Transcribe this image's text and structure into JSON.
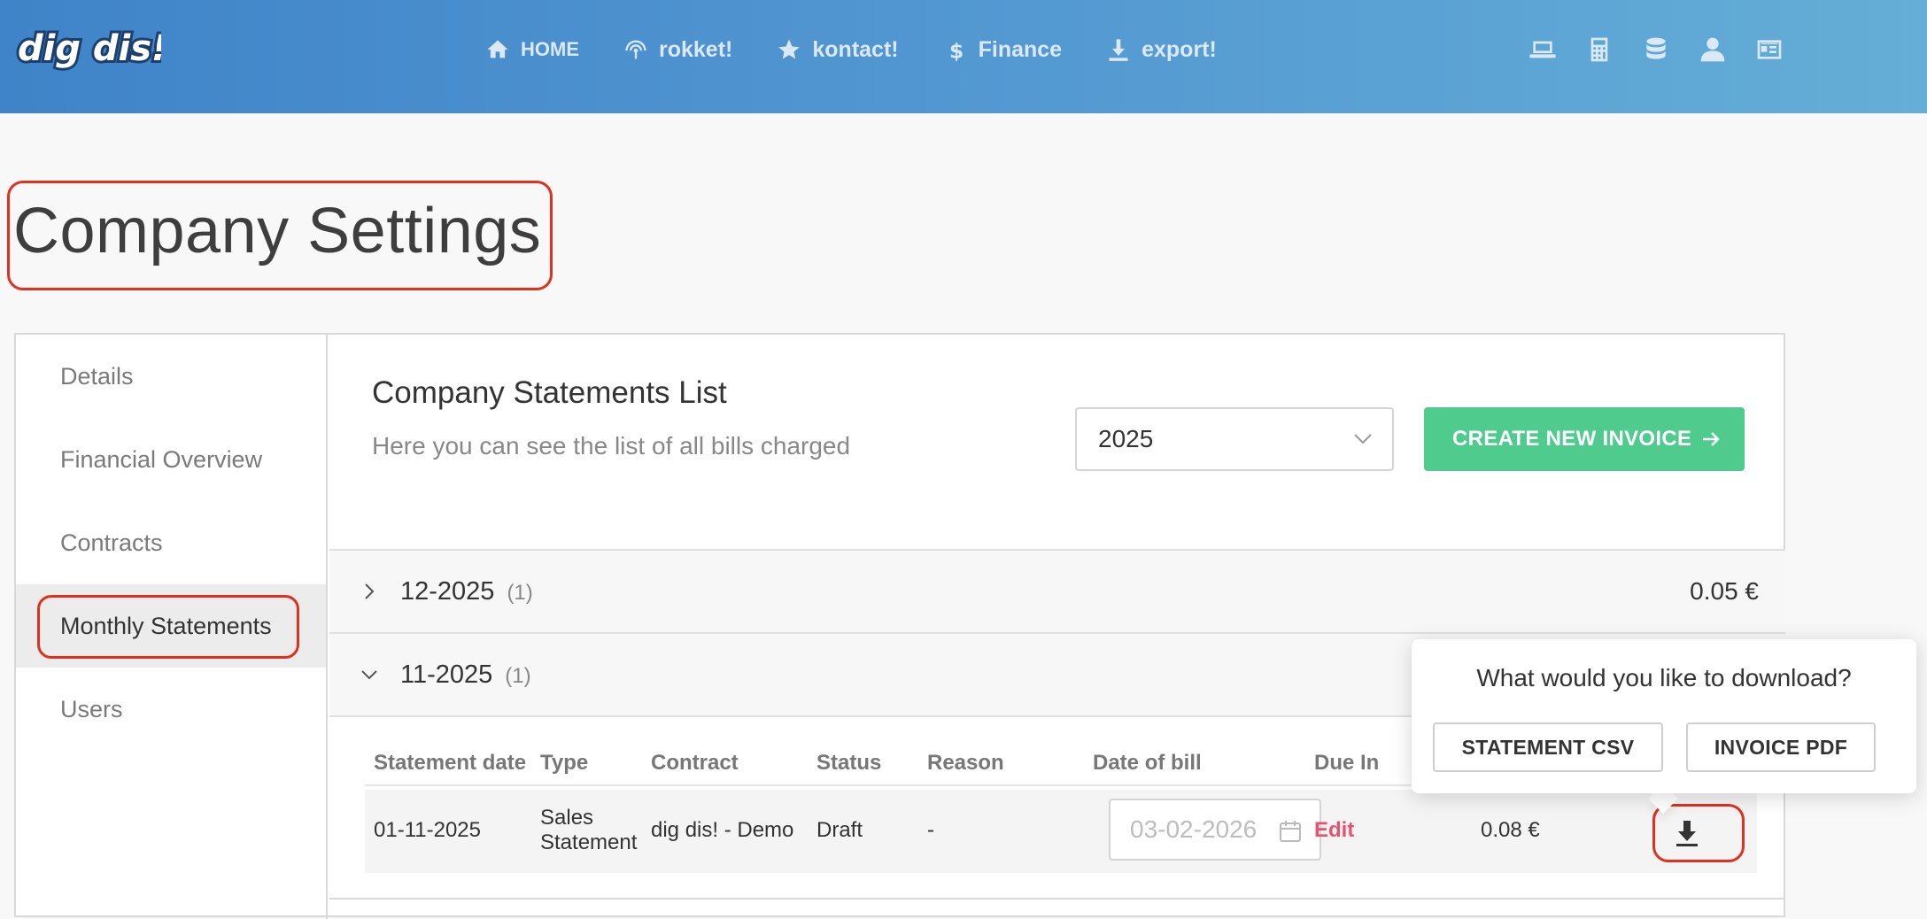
{
  "nav": {
    "logo_text": "dig dis!",
    "items": [
      {
        "label": "HOME",
        "icon": "home-icon"
      },
      {
        "label": "rokket!",
        "icon": "signal-icon"
      },
      {
        "label": "kontact!",
        "icon": "star-icon"
      },
      {
        "label": "Finance",
        "icon": "dollar-icon"
      },
      {
        "label": "export!",
        "icon": "download-icon"
      }
    ],
    "right_icons": [
      "laptop-icon",
      "calculator-icon",
      "database-icon",
      "user-icon",
      "id-card-icon"
    ]
  },
  "page": {
    "title": "Company Settings"
  },
  "sidebar": {
    "items": [
      {
        "label": "Details"
      },
      {
        "label": "Financial Overview"
      },
      {
        "label": "Contracts"
      },
      {
        "label": "Monthly Statements",
        "active": true
      },
      {
        "label": "Users"
      }
    ]
  },
  "statements": {
    "title": "Company Statements List",
    "subtitle": "Here you can see the list of all bills charged",
    "year_selected": "2025",
    "create_button": "CREATE NEW INVOICE",
    "groups": [
      {
        "label": "12-2025",
        "count": "(1)",
        "amount": "0.05 €",
        "expanded": false
      },
      {
        "label": "11-2025",
        "count": "(1)",
        "expanded": true
      }
    ],
    "columns": [
      "Statement date",
      "Type",
      "Contract",
      "Status",
      "Reason",
      "Date of bill",
      "Due In"
    ],
    "row": {
      "statement_date": "01-11-2025",
      "type_line1": "Sales",
      "type_line2": "Statement",
      "contract": "dig dis! - Demo",
      "status": "Draft",
      "reason": "-",
      "date_of_bill": "03-02-2026",
      "due_in": "Edit",
      "amount": "0.08 €"
    }
  },
  "download_popover": {
    "question": "What would you like to download?",
    "statement_csv": "STATEMENT CSV",
    "invoice_pdf": "INVOICE PDF"
  },
  "colors": {
    "accent_green": "#4ecb8d",
    "highlight_red": "#e2301e",
    "edit_pink": "#e8516f",
    "nav_blue_start": "#3f84c8",
    "nav_blue_end": "#64aed7"
  }
}
